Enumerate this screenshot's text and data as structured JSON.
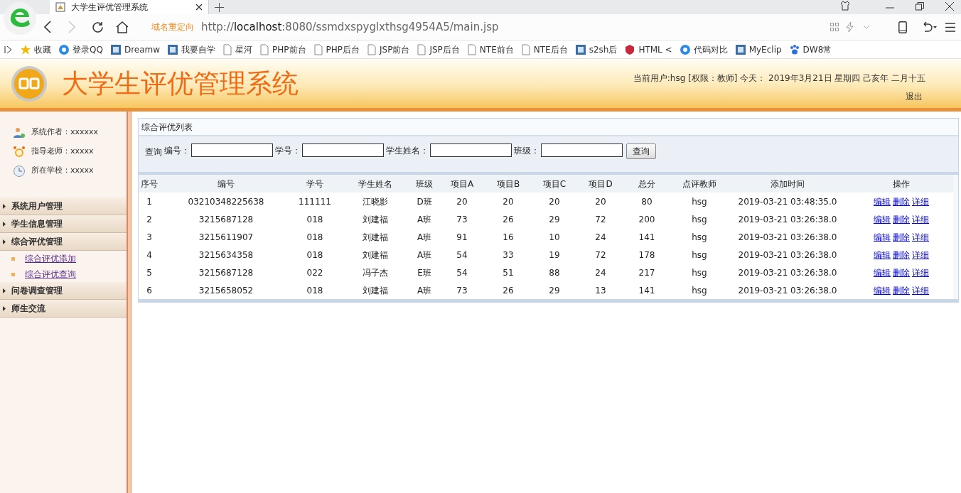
{
  "browser": {
    "tab_title": "大学生评优管理系统",
    "redirect_label": "域名重定向",
    "url_prefix": "http://",
    "url_host": "localhost",
    "url_rest": ":8080/ssmdxspyglxthsg4954A5/main.jsp",
    "bookmarks": [
      {
        "kind": "favorites",
        "label": "收藏"
      },
      {
        "kind": "round",
        "label": "登录QQ"
      },
      {
        "kind": "square",
        "label": "Dreamw"
      },
      {
        "kind": "square",
        "label": "我要自学"
      },
      {
        "kind": "page",
        "label": "星河"
      },
      {
        "kind": "page",
        "label": "PHP前台"
      },
      {
        "kind": "page",
        "label": "PHP后台"
      },
      {
        "kind": "page",
        "label": "JSP前台"
      },
      {
        "kind": "page",
        "label": "JSP后台"
      },
      {
        "kind": "page",
        "label": "NTE前台"
      },
      {
        "kind": "page",
        "label": "NTE后台"
      },
      {
        "kind": "square",
        "label": "s2sh后"
      },
      {
        "kind": "shield",
        "label": "HTML <"
      },
      {
        "kind": "round",
        "label": "代码对比"
      },
      {
        "kind": "square",
        "label": "MyEclip"
      },
      {
        "kind": "paw",
        "label": "DW8常"
      }
    ]
  },
  "header": {
    "title": "大学生评优管理系统",
    "user_info": "当前用户:hsg [权限：教师] 今天： 2019年3月21日 星期四 己亥年 二月十五",
    "logout": "退出"
  },
  "sidebar": {
    "info": [
      {
        "kind": "people",
        "text": "系统作者：xxxxxx"
      },
      {
        "kind": "clock",
        "text": "指导老师：xxxxx"
      },
      {
        "kind": "time",
        "text": "所在学校：xxxxx"
      }
    ],
    "menu": [
      {
        "label": "系统用户管理"
      },
      {
        "label": "学生信息管理"
      },
      {
        "label": "综合评优管理",
        "children": [
          {
            "label": "综合评优添加"
          },
          {
            "label": "综合评优查询"
          }
        ]
      },
      {
        "label": "问卷调查管理"
      },
      {
        "label": "师生交流"
      }
    ]
  },
  "panel": {
    "title": "综合评优列表",
    "search_prefix": "查询",
    "filters": [
      {
        "label": "编号："
      },
      {
        "label": "学号："
      },
      {
        "label": "学生姓名："
      },
      {
        "label": "班级："
      }
    ],
    "search_button": "查询",
    "table": {
      "columns": [
        "序号",
        "编号",
        "学号",
        "学生姓名",
        "班级",
        "项目A",
        "项目B",
        "项目C",
        "项目D",
        "总分",
        "点评教师",
        "添加时间",
        "操作"
      ],
      "rows": [
        {
          "cells": [
            "1",
            "03210348225638",
            "111111",
            "江晓影",
            "D班",
            "20",
            "20",
            "20",
            "20",
            "80",
            "hsg",
            "2019-03-21 03:48:35.0"
          ],
          "actions": [
            "编辑",
            "删除",
            "详细"
          ]
        },
        {
          "cells": [
            "2",
            "3215687128",
            "018",
            "刘建福",
            "A班",
            "73",
            "26",
            "29",
            "72",
            "200",
            "hsg",
            "2019-03-21 03:26:38.0"
          ],
          "actions": [
            "编辑",
            "删除",
            "详细"
          ]
        },
        {
          "cells": [
            "3",
            "3215611907",
            "018",
            "刘建福",
            "A班",
            "91",
            "16",
            "10",
            "24",
            "141",
            "hsg",
            "2019-03-21 03:26:38.0"
          ],
          "actions": [
            "编辑",
            "删除",
            "详细"
          ]
        },
        {
          "cells": [
            "4",
            "3215634358",
            "018",
            "刘建福",
            "A班",
            "54",
            "33",
            "19",
            "72",
            "178",
            "hsg",
            "2019-03-21 03:26:38.0"
          ],
          "actions": [
            "编辑",
            "删除",
            "详细"
          ]
        },
        {
          "cells": [
            "5",
            "3215687128",
            "022",
            "冯子杰",
            "E班",
            "54",
            "51",
            "88",
            "24",
            "217",
            "hsg",
            "2019-03-21 03:26:38.0"
          ],
          "actions": [
            "编辑",
            "删除",
            "详细"
          ]
        },
        {
          "cells": [
            "6",
            "3215658052",
            "018",
            "刘建福",
            "A班",
            "73",
            "26",
            "29",
            "13",
            "141",
            "hsg",
            "2019-03-21 03:26:38.0"
          ],
          "actions": [
            "编辑",
            "删除",
            "详细"
          ]
        }
      ]
    }
  }
}
